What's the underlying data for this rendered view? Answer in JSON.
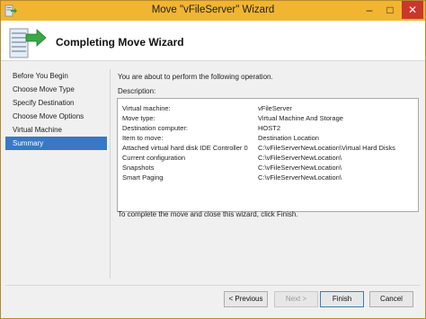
{
  "window": {
    "title": "Move \"vFileServer\" Wizard",
    "minimize_glyph": "–",
    "maximize_glyph": "□",
    "close_glyph": "✕",
    "accent_color": "#f2b531"
  },
  "header": {
    "title": "Completing Move Wizard",
    "icon": "server-arrow-icon"
  },
  "nav": {
    "items": [
      {
        "label": "Before You Begin",
        "selected": false
      },
      {
        "label": "Choose Move Type",
        "selected": false
      },
      {
        "label": "Specify Destination",
        "selected": false
      },
      {
        "label": "Choose Move Options",
        "selected": false
      },
      {
        "label": "Virtual Machine",
        "selected": false
      },
      {
        "label": "Summary",
        "selected": true
      }
    ]
  },
  "main": {
    "intro": "You are about to perform the following operation.",
    "description_label": "Description:",
    "rows": [
      {
        "key": "Virtual machine:",
        "value": "vFileServer"
      },
      {
        "key": "Move type:",
        "value": "Virtual Machine And Storage"
      },
      {
        "key": "Destination computer:",
        "value": "HOST2"
      },
      {
        "key": "Item to move:",
        "value": "Destination Location"
      },
      {
        "key": "Attached virtual hard disk  IDE Controller 0",
        "value": "C:\\vFileServerNewLocation\\Virtual Hard Disks"
      },
      {
        "key": "Current configuration",
        "value": "C:\\vFileServerNewLocation\\"
      },
      {
        "key": "Snapshots",
        "value": "C:\\vFileServerNewLocation\\"
      },
      {
        "key": "Smart Paging",
        "value": "C:\\vFileServerNewLocation\\"
      }
    ],
    "finish_text": "To complete the move and close this wizard, click Finish."
  },
  "buttons": {
    "previous": "< Previous",
    "next": "Next >",
    "finish": "Finish",
    "cancel": "Cancel"
  }
}
